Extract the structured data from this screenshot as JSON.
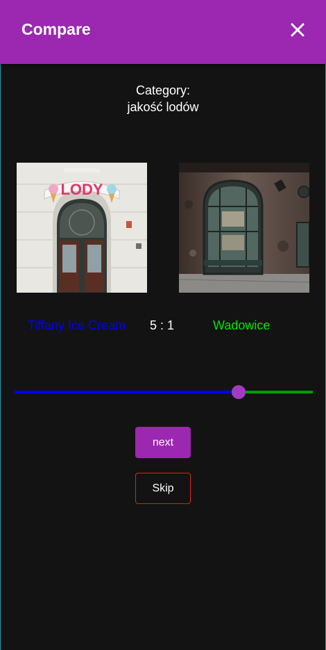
{
  "app_bar": {
    "title": "Compare",
    "close_icon": "close-icon",
    "color": "#9c27b0"
  },
  "category": {
    "label": "Category:",
    "value": "jakość lodów"
  },
  "comparison": {
    "left_name": "Tiffany Ice Cream",
    "right_name": "Wadowice",
    "score": "5 : 1",
    "left_color": "#0000ff",
    "right_color": "#00e600",
    "left_photo_sign": "LODY"
  },
  "slider": {
    "value": 0.75
  },
  "buttons": {
    "next_label": "next",
    "skip_label": "Skip"
  }
}
